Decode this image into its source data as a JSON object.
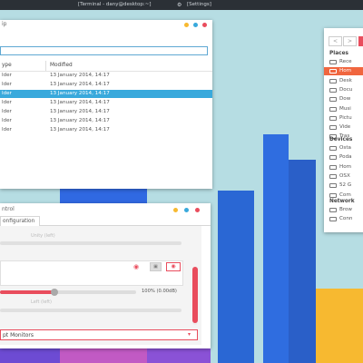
{
  "top_panel": {
    "tasks": [
      "[Terminal - dany@desktop:~]",
      "[Settings]"
    ]
  },
  "file_manager": {
    "title_fragment": "ip",
    "columns": [
      "ype",
      "Modified"
    ],
    "rows": [
      {
        "type": "lder",
        "modified": "13 January 2014, 14:17"
      },
      {
        "type": "lder",
        "modified": "13 January 2014, 14:17"
      },
      {
        "type": "lder",
        "modified": "13 January 2014, 14:17"
      },
      {
        "type": "lder",
        "modified": "13 January 2014, 14:17"
      },
      {
        "type": "lder",
        "modified": "13 January 2014, 14:17"
      },
      {
        "type": "lder",
        "modified": "13 January 2014, 14:17"
      },
      {
        "type": "lder",
        "modified": "13 January 2014, 14:17"
      }
    ],
    "selected_row": 2
  },
  "sidebar_window": {
    "back_label": "<",
    "forward_label": ">",
    "places_heading": "Places",
    "places": [
      "Rece",
      "Hom",
      "Desk",
      "Docu",
      "Dow",
      "Musi",
      "Pictu",
      "Vide",
      "Tras"
    ],
    "selected_place": 1,
    "devices_heading": "Devices",
    "devices": [
      "Osta",
      "Poda",
      "Hom",
      "OSX",
      "52 G",
      "Com"
    ],
    "network_heading": "Network",
    "network": [
      "Brow",
      "Conn"
    ]
  },
  "mixer": {
    "title_fragment": "ntrol",
    "tab_label": "onfiguration",
    "faded_label_top": "Unity (left)",
    "level_text": "100% (0.00dB)",
    "faded_label_bottom": "Left (left)",
    "slider_value_fraction": 0.4,
    "scroll_fraction": 0.35,
    "dropdown_value": "pt Monitors"
  },
  "colors": {
    "accent_red": "#e94d5d",
    "selection_blue": "#39a9dc",
    "sidebar_selection": "#f0663f",
    "building_blue": "#2f6de0",
    "building_light_blue": "#2a7bd8",
    "yellow": "#f7b930",
    "purple": "#6d4bd3",
    "sky": "#b6dde3"
  }
}
